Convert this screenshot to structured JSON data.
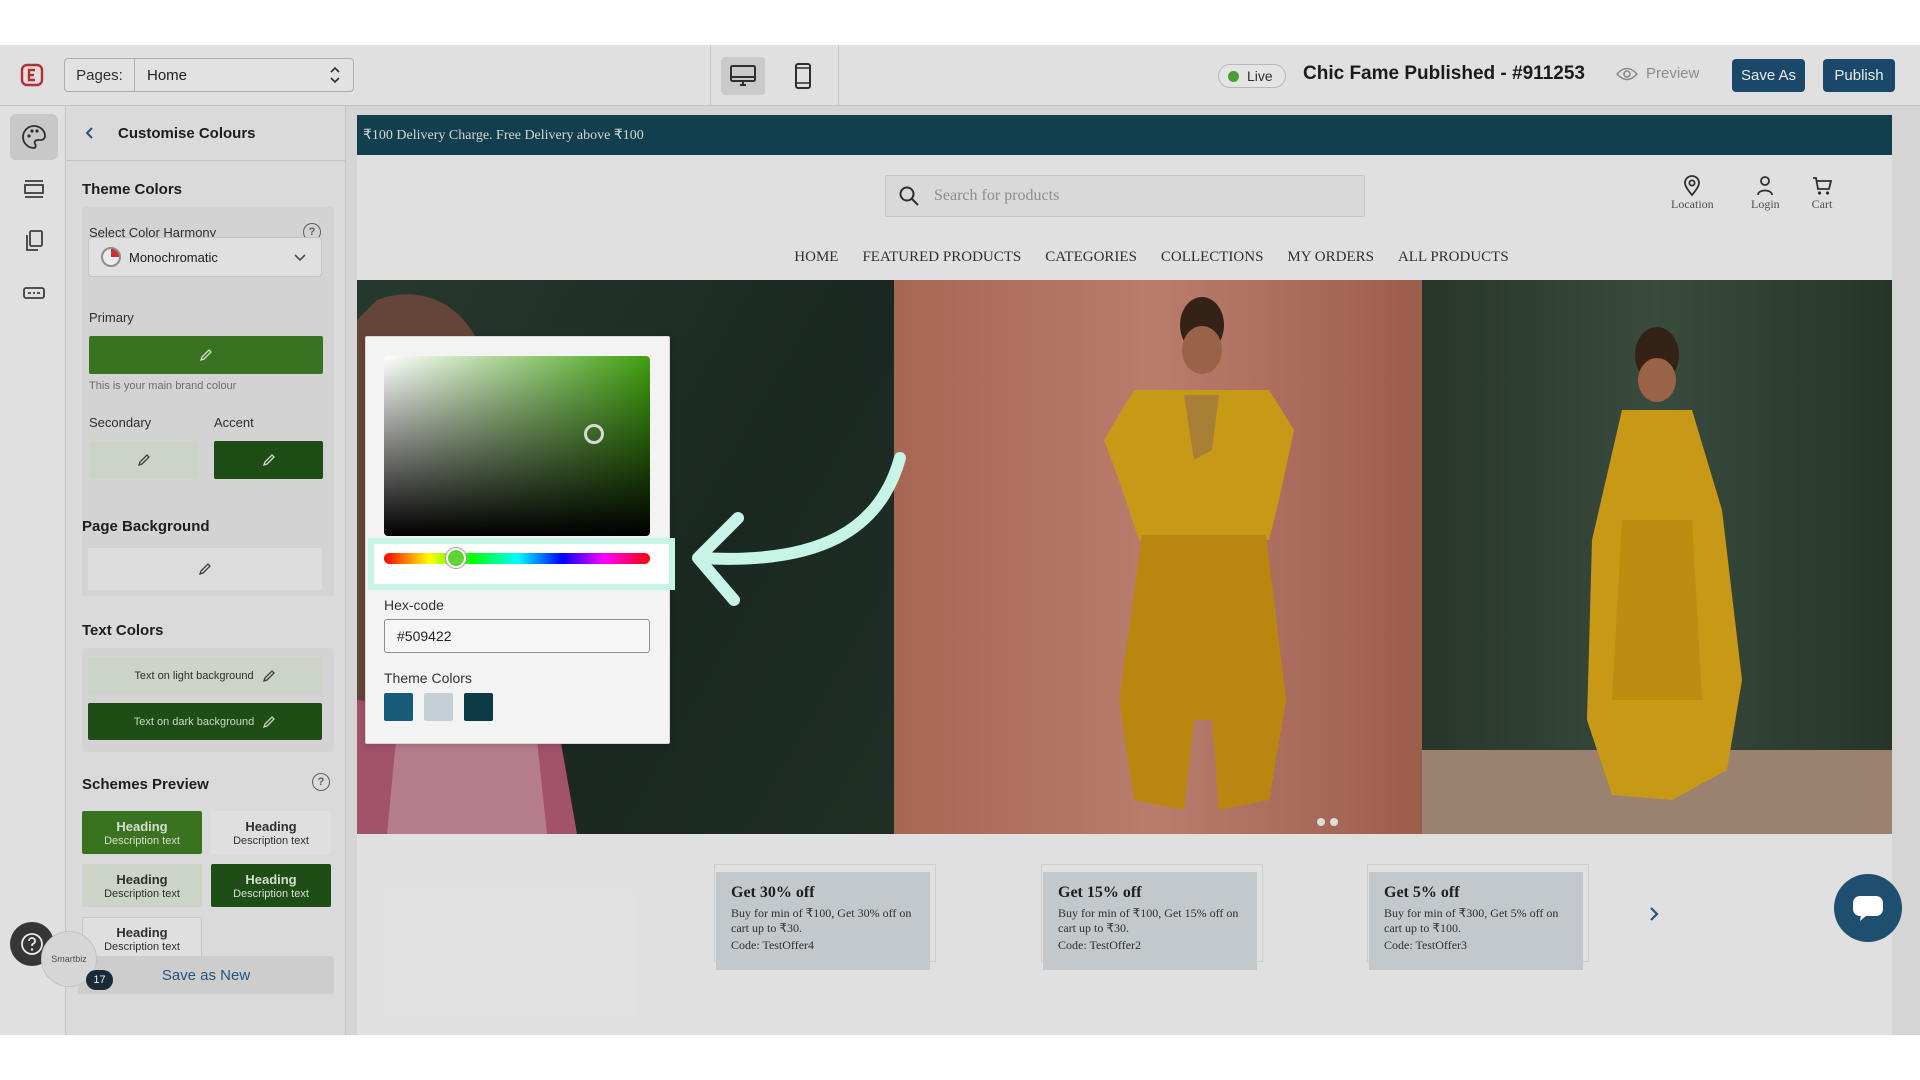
{
  "topbar": {
    "pages_label": "Pages:",
    "pages_value": "Home",
    "live_label": "Live",
    "store_title": "Chic Fame Published - #911253",
    "preview_label": "Preview",
    "save_as_label": "Save As",
    "publish_label": "Publish"
  },
  "panel": {
    "title": "Customise Colours",
    "theme_colors_title": "Theme Colors",
    "harmony_label": "Select Color Harmony",
    "harmony_value": "Monochromatic",
    "primary_label": "Primary",
    "primary_hint": "This is your main brand colour",
    "secondary_label": "Secondary",
    "accent_label": "Accent",
    "page_bg_title": "Page Background",
    "text_colors_title": "Text Colors",
    "text_light": "Text on light background",
    "text_dark": "Text on dark background",
    "schemes_title": "Schemes Preview",
    "schemes": [
      {
        "heading": "Heading",
        "desc": "Description text"
      },
      {
        "heading": "Heading",
        "desc": "Description text"
      },
      {
        "heading": "Heading",
        "desc": "Description text"
      },
      {
        "heading": "Heading",
        "desc": "Description text"
      },
      {
        "heading": "Heading",
        "desc": "Description text"
      }
    ],
    "save_new_label": "Save as New",
    "avatar_text": "Smartbiz",
    "badge_count": "17"
  },
  "colors": {
    "primary": "#3f7d22",
    "secondary": "#dde6d8",
    "accent": "#215518",
    "announce": "#134554",
    "brand_button": "#1d4f73"
  },
  "store": {
    "announcement": "₹100 Delivery Charge. Free Delivery above ₹100",
    "search_placeholder": "Search for products",
    "header_icons": [
      {
        "label": "Location",
        "icon": "location-icon"
      },
      {
        "label": "Login",
        "icon": "user-icon"
      },
      {
        "label": "Cart",
        "icon": "cart-icon"
      }
    ],
    "nav": [
      "HOME",
      "FEATURED PRODUCTS",
      "CATEGORIES",
      "COLLECTIONS",
      "MY ORDERS",
      "ALL PRODUCTS"
    ],
    "offers": [
      {
        "title": "Get 30% off",
        "body": "Buy for min of ₹100, Get 30% off on cart up to ₹30.",
        "code": "Code: TestOffer4"
      },
      {
        "title": "Get 15% off",
        "body": "Buy for min of ₹100, Get 15% off on cart up to ₹30.",
        "code": "Code: TestOffer2"
      },
      {
        "title": "Get 5% off",
        "body": "Buy for min of ₹300, Get 5% off on cart up to ₹100.",
        "code": "Code: TestOffer3"
      }
    ]
  },
  "picker": {
    "hex_label": "Hex-code",
    "hex_value": "#509422",
    "theme_colors_label": "Theme Colors",
    "theme_swatches": [
      "#185a7a",
      "#c5d0d6",
      "#0c3a47"
    ]
  }
}
